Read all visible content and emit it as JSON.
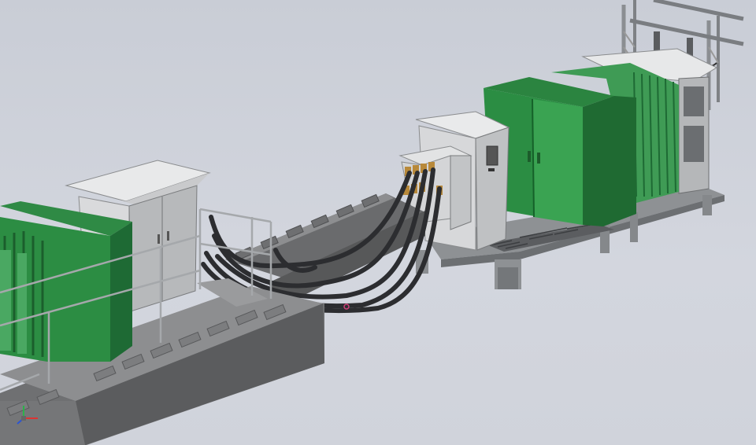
{
  "viewport": {
    "background": "#cfd3dc"
  },
  "scene": {
    "objects": [
      "left-concrete-trench-platform",
      "left-green-transformer",
      "left-grey-switchgear-cabinet",
      "safety-railing",
      "flexible-cable-bundle",
      "cable-trench-channel",
      "small-junction-box",
      "right-grey-control-cabinet",
      "right-green-transformer-cabinet",
      "right-steel-skid-frame",
      "overhead-line-gantry",
      "tall-grey-cabinet-right"
    ]
  },
  "colors": {
    "concrete": "#6f7072",
    "concrete_top": "#8a8b8d",
    "green_dark": "#1e6a34",
    "green_mid": "#2e8a45",
    "green_light": "#48a85e",
    "cabinet_grey": "#c9cbcd",
    "cabinet_light": "#e9eaeb",
    "steel": "#8e9194",
    "cable": "#2c2d30",
    "brass": "#b8893a"
  },
  "triad": {
    "icon": "coordinate-triad-icon"
  }
}
